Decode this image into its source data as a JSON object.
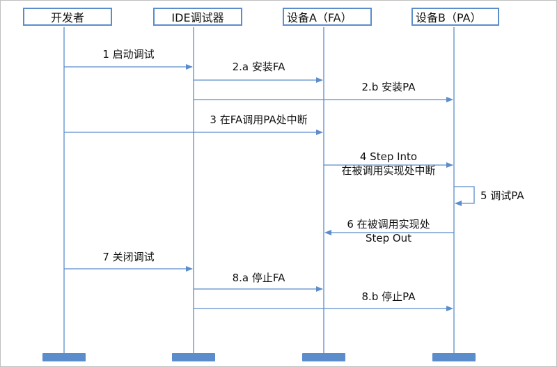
{
  "diagram": {
    "type": "sequence",
    "colors": {
      "line": "#5b8ccb",
      "bar": "#5b8ccb",
      "text": "#111111",
      "border": "#bfbfbf"
    },
    "actors": [
      {
        "id": "dev",
        "label": "开发者"
      },
      {
        "id": "ide",
        "label": "IDE调试器"
      },
      {
        "id": "fa",
        "label": "设备A（FA）"
      },
      {
        "id": "pa",
        "label": "设备B（PA）"
      }
    ],
    "messages": [
      {
        "step": "1",
        "from": "dev",
        "to": "ide",
        "line1": "1 启动调试",
        "line2": ""
      },
      {
        "step": "2.a",
        "from": "ide",
        "to": "fa",
        "line1": "2.a  安装FA",
        "line2": ""
      },
      {
        "step": "2.b",
        "from": "ide",
        "to": "pa",
        "line1": "2.b  安装PA",
        "line2": ""
      },
      {
        "step": "3",
        "from": "dev",
        "to": "fa",
        "line1": "3  在FA调用PA处中断",
        "line2": ""
      },
      {
        "step": "4",
        "from": "fa",
        "to": "pa",
        "line1": "4  Step Into",
        "line2": "在被调用实现处中断"
      },
      {
        "step": "5",
        "from": "pa",
        "to": "pa",
        "line1": "5  调试PA",
        "line2": ""
      },
      {
        "step": "6",
        "from": "pa",
        "to": "fa",
        "line1": "6 在被调用实现处",
        "line2": "Step Out"
      },
      {
        "step": "7",
        "from": "dev",
        "to": "ide",
        "line1": "7  关闭调试",
        "line2": ""
      },
      {
        "step": "8.a",
        "from": "ide",
        "to": "fa",
        "line1": "8.a  停止FA",
        "line2": ""
      },
      {
        "step": "8.b",
        "from": "ide",
        "to": "pa",
        "line1": "8.b 停止PA",
        "line2": ""
      }
    ]
  }
}
